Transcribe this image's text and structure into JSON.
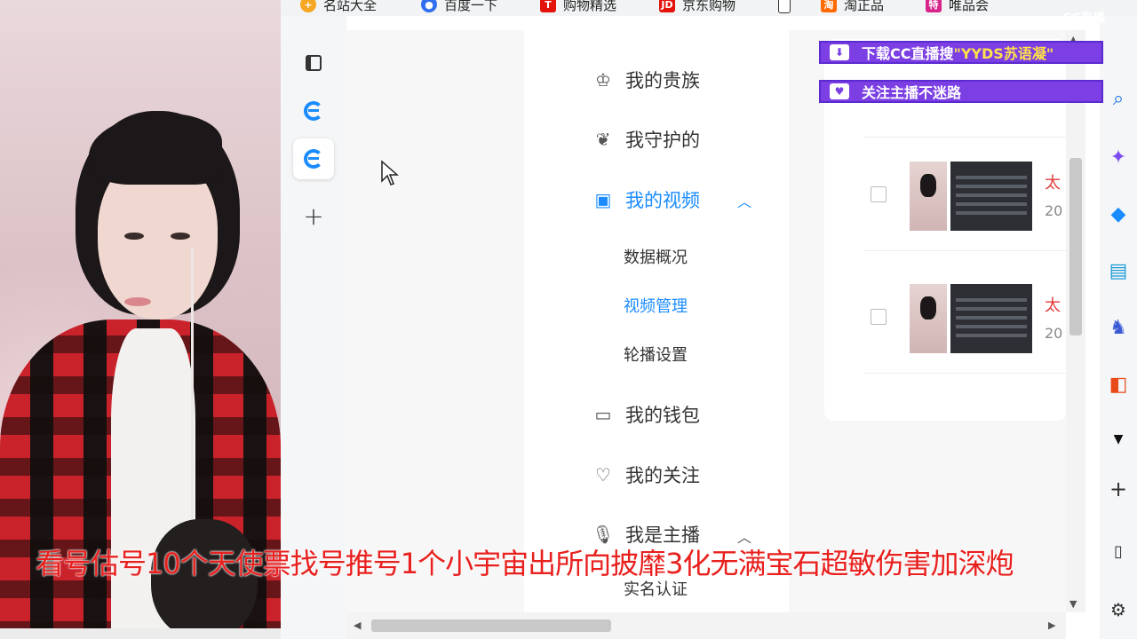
{
  "bookmarks": [
    {
      "label": "名站大全",
      "icon": "plus-circle-icon",
      "color": "#f5a623"
    },
    {
      "label": "百度一下",
      "icon": "baidu-paw-icon",
      "color": "#2f6ff0"
    },
    {
      "label": "购物精选",
      "icon": "t-box-icon",
      "color": "#e3120b"
    },
    {
      "label": "京东购物",
      "icon": "jd-icon",
      "color": "#e3120b"
    },
    {
      "label": "淘正品",
      "icon": "tao-icon",
      "color": "#ff6a00"
    },
    {
      "label": "唯品会",
      "icon": "te-icon",
      "color": "#d6248b"
    }
  ],
  "menu": {
    "items": [
      {
        "label": "我的贵族",
        "icon": "crown-icon"
      },
      {
        "label": "我守护的",
        "icon": "wings-icon"
      },
      {
        "label": "我的视频",
        "icon": "video-icon",
        "active": true
      },
      {
        "label": "我的钱包",
        "icon": "wallet-icon"
      },
      {
        "label": "我的关注",
        "icon": "heart-icon"
      },
      {
        "label": "我是主播",
        "icon": "mic-icon"
      }
    ],
    "video_sub": [
      "数据概况",
      "视频管理",
      "轮播设置"
    ],
    "anchor_sub": [
      "实名认证"
    ]
  },
  "videos": [
    {
      "title": "太",
      "date": "20"
    },
    {
      "title": "太",
      "date": "20"
    }
  ],
  "overlay": {
    "banner1_prefix": "下载CC直播搜",
    "banner1_highlight": "\"YYDS苏语凝\"",
    "banner2": "关注主播不迷路",
    "watermark": "CC直播",
    "scroll_text": "看号估号10个天使票找号推号1个小宇宙出所向披靡3化无满宝石超敏伤害加深炮"
  },
  "colors": {
    "accent": "#1a8cff",
    "banner": "#7b3fe4",
    "scroll_text": "#e8201e"
  }
}
